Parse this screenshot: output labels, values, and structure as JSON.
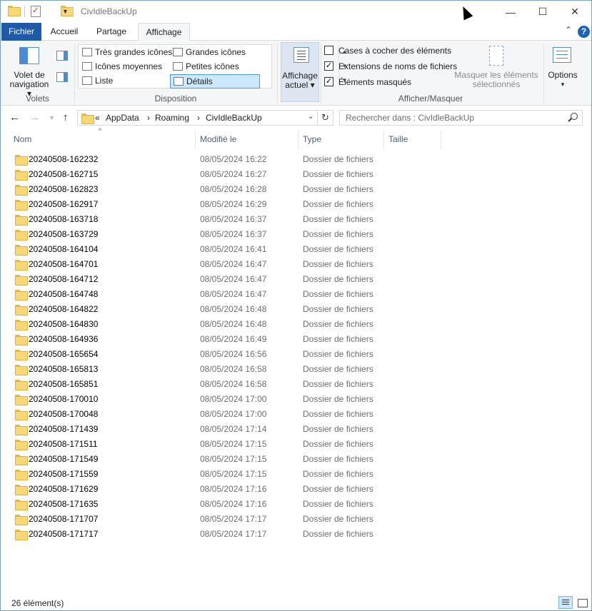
{
  "window": {
    "title": "CivIdleBackUp",
    "minimize_glyph": "—",
    "maximize_glyph": "☐",
    "close_glyph": "✕"
  },
  "ribbon_tabs": [
    {
      "label": "Fichier"
    },
    {
      "label": "Accueil"
    },
    {
      "label": "Partage"
    },
    {
      "label": "Affichage"
    }
  ],
  "ribbon": {
    "panes_group": "Volets",
    "nav_pane_label_1": "Volet de",
    "nav_pane_label_2": "navigation ▾",
    "layout_group": "Disposition",
    "layout_items": [
      {
        "label": "Très grandes icônes"
      },
      {
        "label": "Grandes icônes"
      },
      {
        "label": "Icônes moyennes"
      },
      {
        "label": "Petites icônes"
      },
      {
        "label": "Liste"
      },
      {
        "label": "Détails"
      }
    ],
    "current_view_1": "Affichage",
    "current_view_2": "actuel ▾",
    "showhide_group": "Afficher/Masquer",
    "checkboxes": [
      {
        "label": "Cases à cocher des éléments",
        "checked": false
      },
      {
        "label": "Extensions de noms de fichiers",
        "checked": true
      },
      {
        "label": "Éléments masqués",
        "checked": true
      }
    ],
    "hide_selected_1": "Masquer les éléments",
    "hide_selected_2": "sélectionnés",
    "options_label": "Options",
    "options_arrow": "▾"
  },
  "address": {
    "crumbs": [
      "«",
      "AppData",
      "›",
      "Roaming",
      "›",
      "CivIdleBackUp"
    ],
    "search_placeholder": "Rechercher dans : CivIdleBackUp"
  },
  "columns": {
    "name": "Nom",
    "modified": "Modifié le",
    "type": "Type",
    "size": "Taille"
  },
  "files": [
    {
      "name": "20240508-162232",
      "modified": "08/05/2024 16:22",
      "type": "Dossier de fichiers",
      "size": ""
    },
    {
      "name": "20240508-162715",
      "modified": "08/05/2024 16:27",
      "type": "Dossier de fichiers",
      "size": ""
    },
    {
      "name": "20240508-162823",
      "modified": "08/05/2024 16:28",
      "type": "Dossier de fichiers",
      "size": ""
    },
    {
      "name": "20240508-162917",
      "modified": "08/05/2024 16:29",
      "type": "Dossier de fichiers",
      "size": ""
    },
    {
      "name": "20240508-163718",
      "modified": "08/05/2024 16:37",
      "type": "Dossier de fichiers",
      "size": ""
    },
    {
      "name": "20240508-163729",
      "modified": "08/05/2024 16:37",
      "type": "Dossier de fichiers",
      "size": ""
    },
    {
      "name": "20240508-164104",
      "modified": "08/05/2024 16:41",
      "type": "Dossier de fichiers",
      "size": ""
    },
    {
      "name": "20240508-164701",
      "modified": "08/05/2024 16:47",
      "type": "Dossier de fichiers",
      "size": ""
    },
    {
      "name": "20240508-164712",
      "modified": "08/05/2024 16:47",
      "type": "Dossier de fichiers",
      "size": ""
    },
    {
      "name": "20240508-164748",
      "modified": "08/05/2024 16:47",
      "type": "Dossier de fichiers",
      "size": ""
    },
    {
      "name": "20240508-164822",
      "modified": "08/05/2024 16:48",
      "type": "Dossier de fichiers",
      "size": ""
    },
    {
      "name": "20240508-164830",
      "modified": "08/05/2024 16:48",
      "type": "Dossier de fichiers",
      "size": ""
    },
    {
      "name": "20240508-164936",
      "modified": "08/05/2024 16:49",
      "type": "Dossier de fichiers",
      "size": ""
    },
    {
      "name": "20240508-165654",
      "modified": "08/05/2024 16:56",
      "type": "Dossier de fichiers",
      "size": ""
    },
    {
      "name": "20240508-165813",
      "modified": "08/05/2024 16:58",
      "type": "Dossier de fichiers",
      "size": ""
    },
    {
      "name": "20240508-165851",
      "modified": "08/05/2024 16:58",
      "type": "Dossier de fichiers",
      "size": ""
    },
    {
      "name": "20240508-170010",
      "modified": "08/05/2024 17:00",
      "type": "Dossier de fichiers",
      "size": ""
    },
    {
      "name": "20240508-170048",
      "modified": "08/05/2024 17:00",
      "type": "Dossier de fichiers",
      "size": ""
    },
    {
      "name": "20240508-171439",
      "modified": "08/05/2024 17:14",
      "type": "Dossier de fichiers",
      "size": ""
    },
    {
      "name": "20240508-171511",
      "modified": "08/05/2024 17:15",
      "type": "Dossier de fichiers",
      "size": ""
    },
    {
      "name": "20240508-171549",
      "modified": "08/05/2024 17:15",
      "type": "Dossier de fichiers",
      "size": ""
    },
    {
      "name": "20240508-171559",
      "modified": "08/05/2024 17:15",
      "type": "Dossier de fichiers",
      "size": ""
    },
    {
      "name": "20240508-171629",
      "modified": "08/05/2024 17:16",
      "type": "Dossier de fichiers",
      "size": ""
    },
    {
      "name": "20240508-171635",
      "modified": "08/05/2024 17:16",
      "type": "Dossier de fichiers",
      "size": ""
    },
    {
      "name": "20240508-171707",
      "modified": "08/05/2024 17:17",
      "type": "Dossier de fichiers",
      "size": ""
    },
    {
      "name": "20240508-171717",
      "modified": "08/05/2024 17:17",
      "type": "Dossier de fichiers",
      "size": ""
    }
  ],
  "status": {
    "count_text": "26 élément(s)"
  },
  "icons": {
    "title_folder": "folder-icon",
    "properties": "properties-check-icon",
    "new_folder": "new-folder-icon",
    "customize": "chevron-down-icon",
    "back": "arrow-left-icon",
    "forward": "arrow-right-icon",
    "recent": "chevron-down-icon",
    "up": "arrow-up-icon",
    "refresh": "refresh-icon",
    "search": "search-icon",
    "help": "help-icon"
  },
  "colors": {
    "file_tab": "#1e5aa8",
    "selection": "#cce8ff",
    "folder": "#f8d775",
    "secondary_text": "#6d6d6d"
  }
}
